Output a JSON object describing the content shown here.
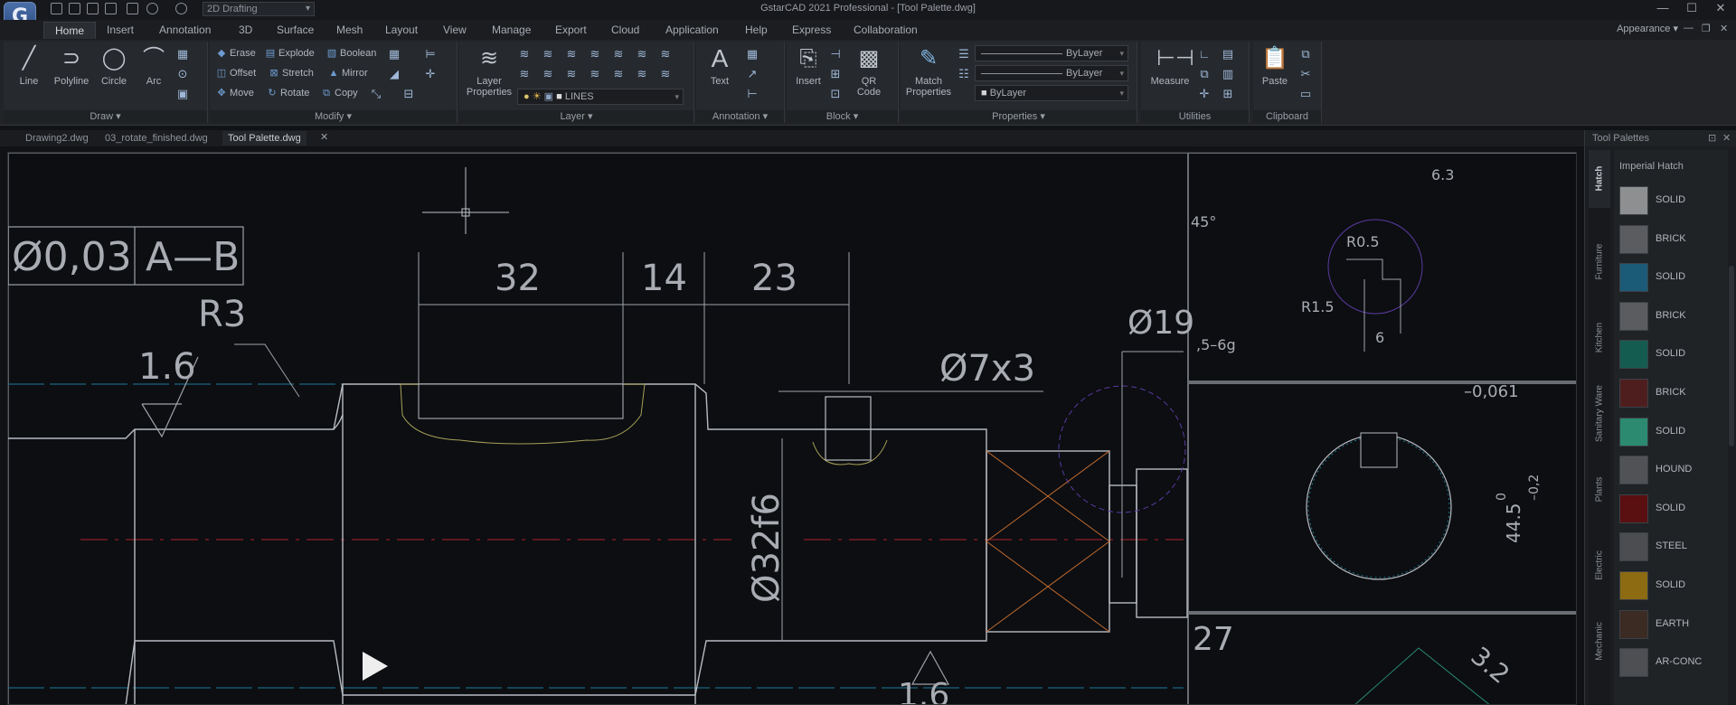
{
  "window": {
    "title": "GstarCAD 2021 Professional - [Tool Palette.dwg]",
    "logo": "G",
    "workspace": "2D Drafting",
    "minimize": "—",
    "maximize": "☐",
    "close": "✕"
  },
  "ribbon_tabs": [
    "Home",
    "Insert",
    "Annotation",
    "3D",
    "Surface",
    "Mesh",
    "Layout",
    "View",
    "Manage",
    "Export",
    "Cloud",
    "Application",
    "Help",
    "Express",
    "Collaboration"
  ],
  "appearance": "Appearance",
  "sub_window": {
    "minimize": "—",
    "restore": "❐",
    "close": "✕"
  },
  "panels": {
    "draw": {
      "title": "Draw",
      "tools": [
        "Line",
        "Polyline",
        "Circle",
        "Arc"
      ]
    },
    "modify": {
      "title": "Modify",
      "tools": [
        "Erase",
        "Explode",
        "Boolean",
        "Offset",
        "Stretch",
        "Mirror",
        "Move",
        "Rotate",
        "Copy"
      ]
    },
    "layer": {
      "title": "Layer",
      "big_tool": "Layer\nProperties",
      "big_tool_line1": "Layer",
      "big_tool_line2": "Properties",
      "current_layer": "LINES"
    },
    "annotation": {
      "title": "Annotation",
      "tool": "Text"
    },
    "block": {
      "title": "Block",
      "tools": [
        "Insert"
      ],
      "qr_line1": "QR",
      "qr_line2": "Code"
    },
    "properties": {
      "title": "Properties",
      "match_line1": "Match",
      "match_line2": "Properties",
      "color": "ByLayer",
      "linetype": "ByLayer",
      "lineweight": "ByLayer"
    },
    "utilities": {
      "title": "Utilities",
      "tool": "Measure"
    },
    "clipboard": {
      "title": "Clipboard",
      "tool": "Paste"
    }
  },
  "doc_tabs": [
    "Drawing2.dwg",
    "03_rotate_finished.dwg",
    "Tool Palette.dwg"
  ],
  "doc_tab_close": "✕",
  "drawing": {
    "tolerance_symbol": "Ø0,03",
    "datum": "A—B",
    "dims": [
      "32",
      "14",
      "23"
    ],
    "radius": "R3",
    "roughness": "1.6",
    "hole": "Ø7x3",
    "diameter_vertical": "Ø32f6",
    "diameter_partial": "Ø19",
    "detail1": {
      "roughness": "6.3",
      "angle": "45°",
      "r1": "R0.5",
      "r2": "R1.5",
      "dim": "6",
      "thread": ",5–6g"
    },
    "detail2": {
      "tol": "–0,061",
      "dim": "44.5",
      "dim_tol_top": "0",
      "dim_tol_bottom": "–0,2"
    },
    "detail3": {
      "dim": "27",
      "roughness": "3.2"
    },
    "bottom_roughness": "1.6"
  },
  "tool_palette": {
    "title": "Tool Palettes",
    "close": "✕",
    "pin": "⊡",
    "side_tabs": [
      "Hatch",
      "Furniture",
      "Kitchen",
      "Sanitary Ware",
      "Plants",
      "Electric",
      "Mechanic"
    ],
    "category": "Imperial Hatch",
    "items": [
      {
        "label": "SOLID",
        "color": "#8e8f91"
      },
      {
        "label": "BRICK",
        "color": "#5a5c5f"
      },
      {
        "label": "SOLID",
        "color": "#1b5b78"
      },
      {
        "label": "BRICK",
        "color": "#5a5c5f"
      },
      {
        "label": "SOLID",
        "color": "#155c50"
      },
      {
        "label": "BRICK",
        "color": "#4e1e1e"
      },
      {
        "label": "SOLID",
        "color": "#2b8a70"
      },
      {
        "label": "HOUND",
        "color": "#505255"
      },
      {
        "label": "SOLID",
        "color": "#5a0f10"
      },
      {
        "label": "STEEL",
        "color": "#4b4d50"
      },
      {
        "label": "SOLID",
        "color": "#8c6b12"
      },
      {
        "label": "EARTH",
        "color": "#3b2b22"
      },
      {
        "label": "AR-CONC",
        "color": "#4d4f52"
      }
    ]
  }
}
